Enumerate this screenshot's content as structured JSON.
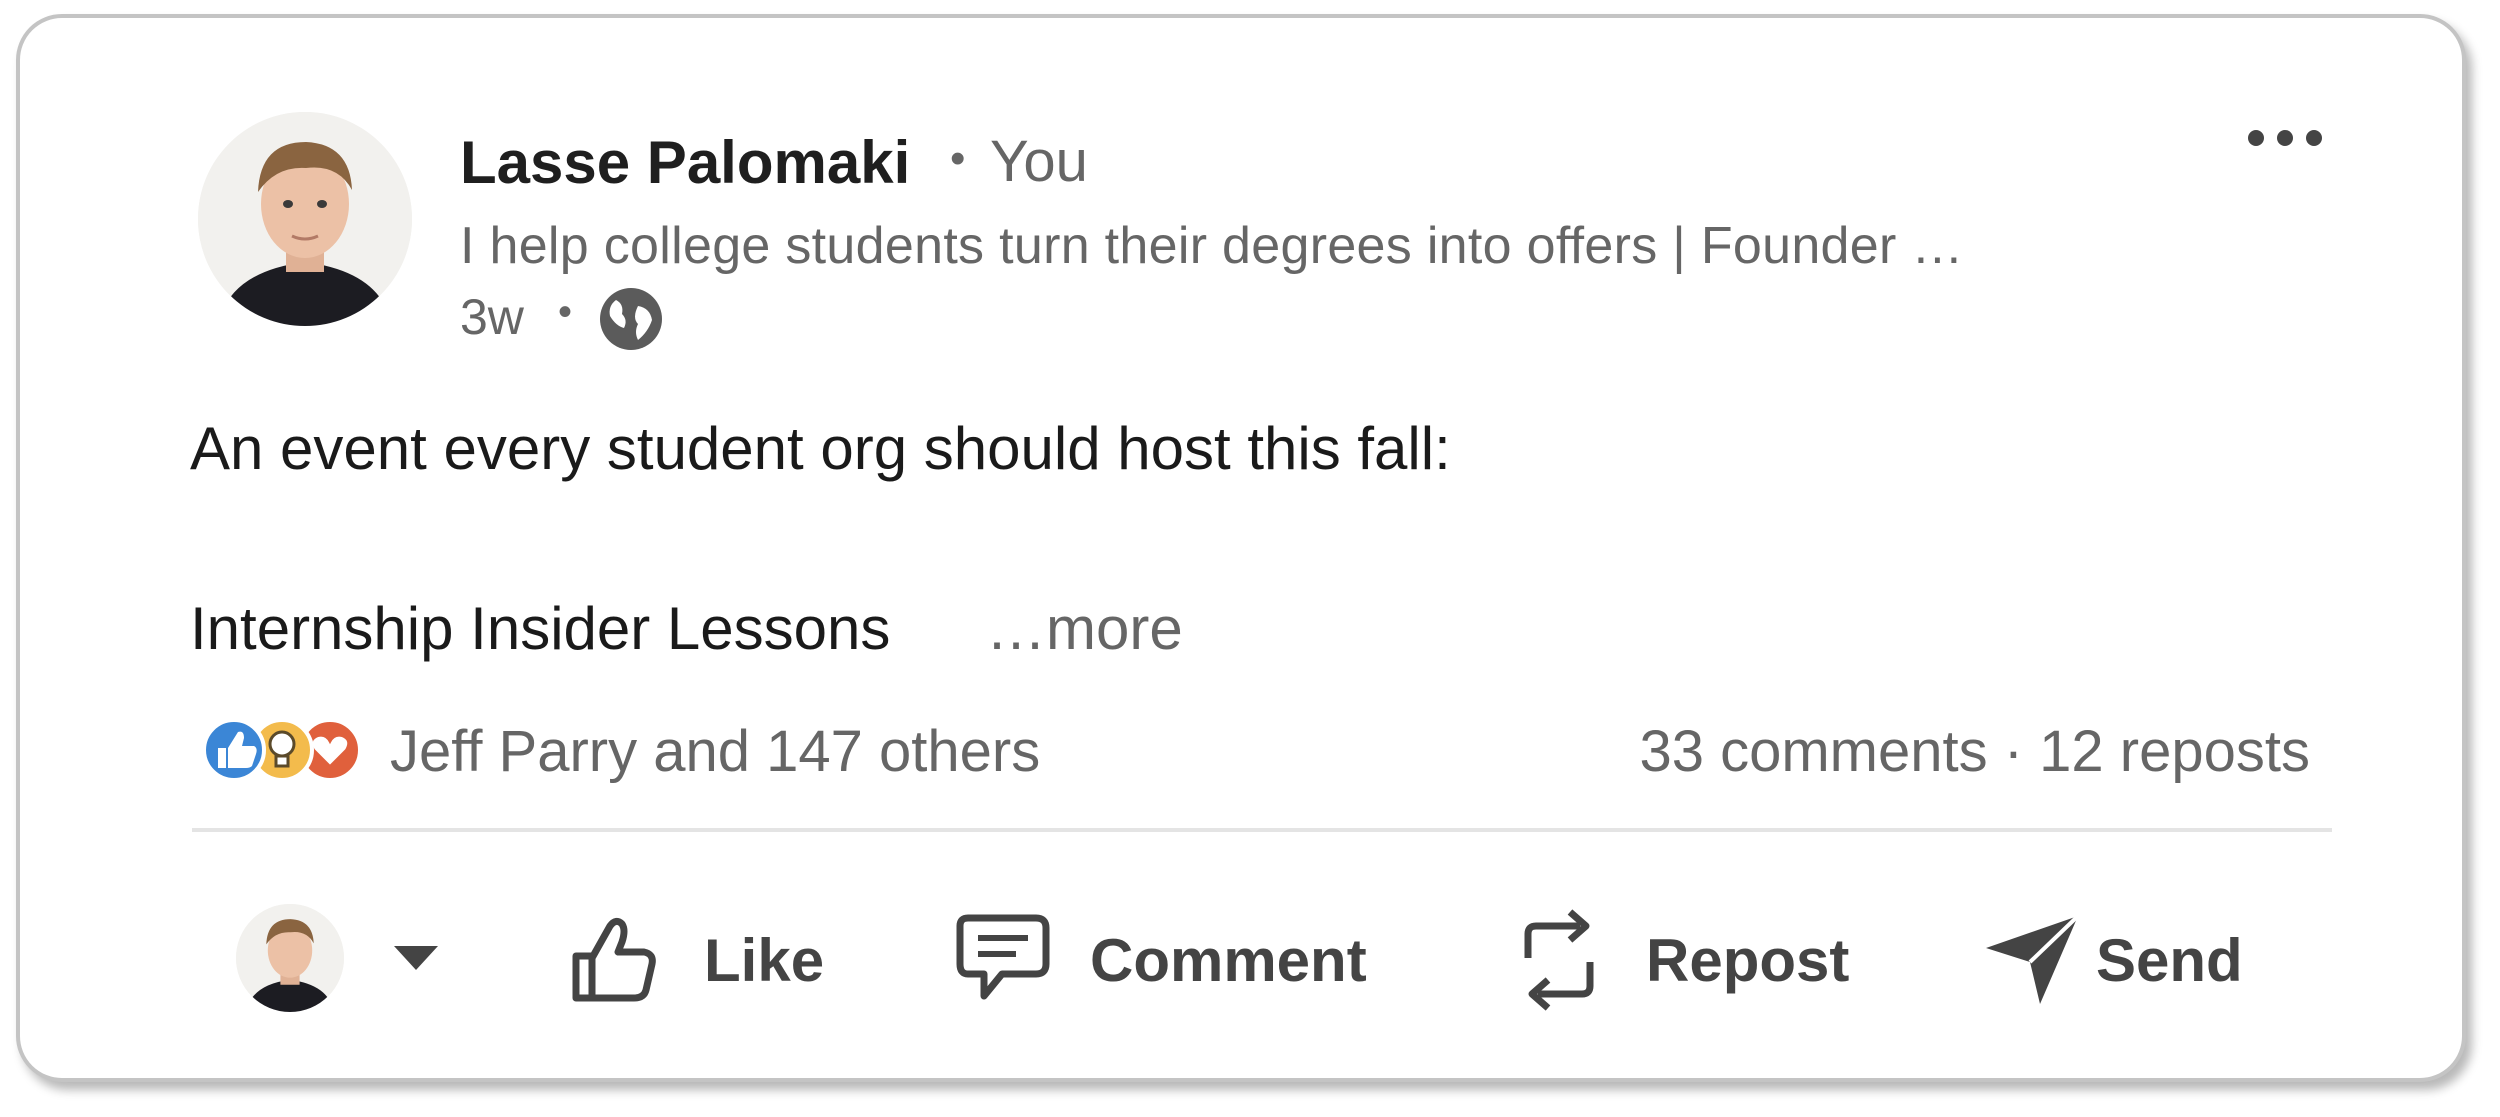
{
  "post": {
    "author": {
      "name": "Lasse Palomaki",
      "separator": "•",
      "relation": "You",
      "headline": "I help college students turn their degrees into offers | Founder …",
      "time": "3w",
      "time_separator": "•",
      "visibility_icon": "globe-icon"
    },
    "more_menu_icon": "ellipsis-icon",
    "body": {
      "line1": "An event every student org should host this fall:",
      "line2": "Internship Insider Lessons",
      "see_more": "…more"
    },
    "social": {
      "reaction_icons": [
        "like-reaction-icon",
        "insightful-reaction-icon",
        "love-reaction-icon"
      ],
      "reactions_text": "Jeff Parry and 147 others",
      "counts_text": "33 comments · 12 reposts"
    },
    "actions": {
      "like": "Like",
      "comment": "Comment",
      "repost": "Repost",
      "send": "Send"
    }
  },
  "colors": {
    "like_blue": "#3b86d6",
    "insightful_yellow": "#f3bb4c",
    "love_red": "#e0603c",
    "text_primary": "#1f1f1f",
    "text_secondary": "#666666",
    "action_gray": "#444444"
  }
}
